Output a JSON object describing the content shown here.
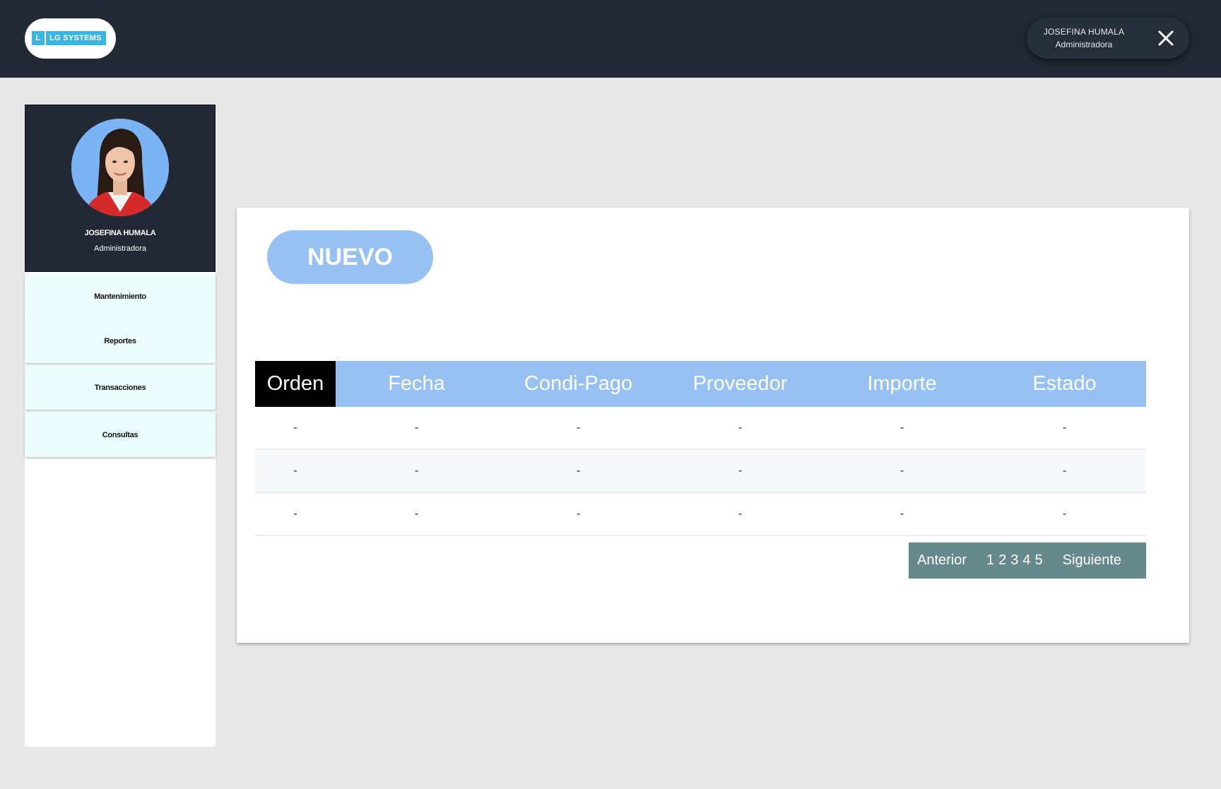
{
  "header": {
    "logo": {
      "letter": "L",
      "name": "LG SYSTEMS"
    },
    "user": {
      "name": "JOSEFINA HUMALA",
      "role": "Administradora"
    },
    "close_icon": "close-icon"
  },
  "sidebar": {
    "profile": {
      "name": "JOSEFINA HUMALA",
      "role": "Administradora",
      "avatar": "avatar-photo"
    },
    "items": [
      {
        "label": "Mantenimiento"
      },
      {
        "label": "Reportes"
      },
      {
        "label": "Transacciones"
      },
      {
        "label": "Consultas"
      }
    ]
  },
  "main": {
    "new_button": "NUEVO",
    "table": {
      "columns": [
        "Orden",
        "Fecha",
        "Condi-Pago",
        "Proveedor",
        "Importe",
        "Estado"
      ],
      "rows": [
        [
          "-",
          "-",
          "-",
          "-",
          "-",
          "-"
        ],
        [
          "-",
          "-",
          "-",
          "-",
          "-",
          "-"
        ],
        [
          "-",
          "-",
          "-",
          "-",
          "-",
          "-"
        ]
      ]
    },
    "pagination": {
      "prev": "Anterior",
      "pages": [
        "1",
        "2",
        "3",
        "4",
        "5"
      ],
      "next": "Siguiente"
    }
  },
  "colors": {
    "topbar": "#222934",
    "accent": "#97c1f3",
    "menu_item": "#ebfdfc",
    "pager": "#668a8b",
    "logo": "#3ab4e4"
  }
}
